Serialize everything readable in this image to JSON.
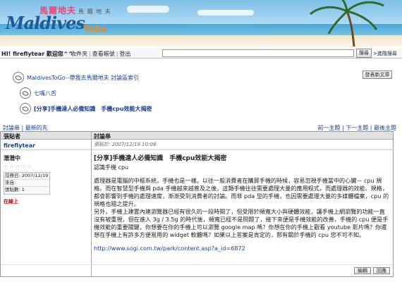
{
  "banner": {
    "logo_cn": "馬爾地夫",
    "logo_cn_sub": "馬 爾 地 夫",
    "logo_en": "Maldives",
    "logo_togo": "ToGo"
  },
  "userbar": {
    "greeting": "HI! fireflytear 歡迎您^^",
    "links": [
      "收件夾",
      "查看帳號",
      "登出"
    ],
    "search_button": "搜尋",
    "advanced_search": ">進階搜尋"
  },
  "new_post_button": "發表新文章",
  "breadcrumb": [
    "MaldivesToGo--帶我去馬爾地夫 討論區索引",
    "七嘴八舌",
    "[分享]手機達人必備知識　手機cpu效能大揭密"
  ],
  "thread_nav": {
    "left": [
      "討論串",
      "最新的先"
    ],
    "right": [
      "前一主題",
      "下一主題",
      "最後主題"
    ]
  },
  "post": {
    "header_author": "張貼者",
    "header_thread": "討論串",
    "author": "fireflytear",
    "posted_at": "張貼於: 2007/12/19 10:08",
    "rank": "潛潛中",
    "stars": "☆☆☆☆☆",
    "info": [
      "註冊日: 2007/12/19",
      "來自:",
      "張貼數: 1"
    ],
    "online_status": "在線上",
    "title": "[分享]手機達人必備知識　手機cpu效能大揭密",
    "subtitle": "認識手機 cpu",
    "paragraph1": "處理器是電腦的中樞系統，手機也是一樣。以往一般消費者在購買手機的時候，容易忽視手機當中的心臟－ cpu 規格。而在智慧型手機與 pda 手機越來越普及之後，這類手機往往需要處理大量的應用程式，而處理器的效能、規格，都會影響到手機的處理速度，漸漸受到消費者的討論。而非 pda 型的手機，也因需要處理大量的多媒體檔案，cpu 的規格也隨之提升。",
    "paragraph2": "另外，手機上建置內建瀏覽器已經有很久的一段時間了，但受限於頻寬大小與硬體效能，讓手機上網瀏覽的功能一直沒有被重視，但在進入 3g / 3.5g 的時代後，頻寬已經不是問題了，接下來便是手機效能的改善，手機的 cpu 便是手機效能的重要關鍵，你想要在你的手機上可以瀏覽 google map 嗎？你想在你的手機上觀看 youtube 影片嗎？你還想在手機上有許多方便易用的 widget 軟體嗎？如果以上答案是肯定的，那有關於手機的 cpu 您不可不知。",
    "url": "http://www.sogi.com.tw/park/content.asp?a_id=6872",
    "edit_button": "編輯",
    "reply_button": "回應"
  },
  "colors": {
    "link": "#1a3f8f",
    "online": "#cc0000",
    "header_bg": "#e2e2e2"
  }
}
